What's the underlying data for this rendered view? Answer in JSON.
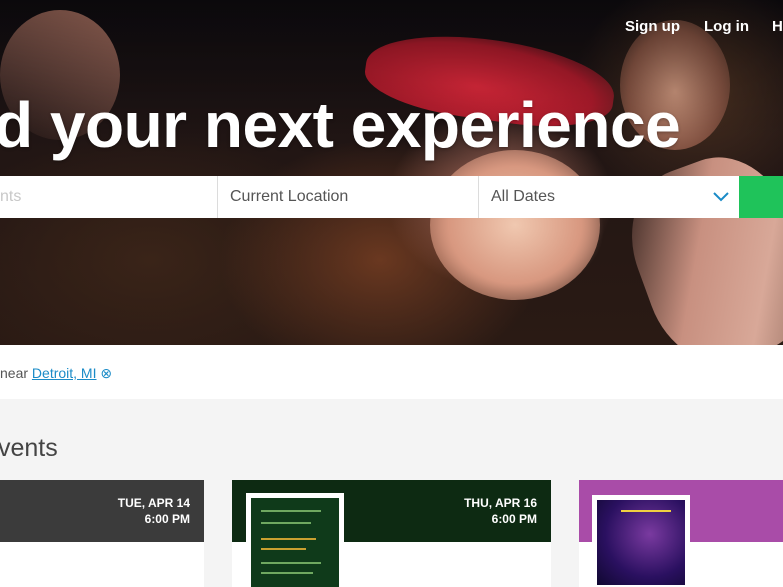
{
  "nav": {
    "signup": "Sign up",
    "login": "Log in",
    "help": "H"
  },
  "hero": {
    "headline": "d your next experience"
  },
  "search": {
    "events_placeholder": "nts",
    "location_value": "Current Location",
    "dates_value": "All Dates"
  },
  "filter": {
    "prefix": "near",
    "location": "Detroit, MI",
    "clear_icon": "⊗"
  },
  "section": {
    "title": "vents"
  },
  "cards": [
    {
      "day": "TUE, APR 14",
      "time": "6:00 PM",
      "color": "#3b3b3b"
    },
    {
      "day": "THU, APR 16",
      "time": "6:00 PM",
      "color": "#0d2a12"
    },
    {
      "day": "",
      "time": "",
      "color": "#a94ca8"
    }
  ],
  "colors": {
    "accent": "#1fc35a",
    "link": "#1a8bc7"
  }
}
